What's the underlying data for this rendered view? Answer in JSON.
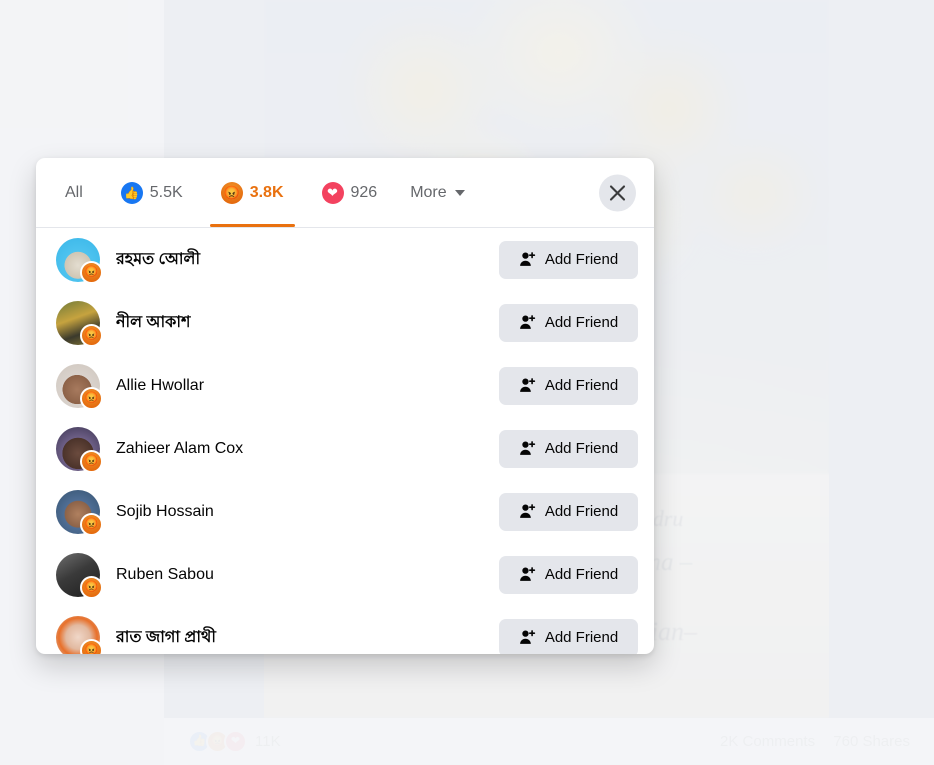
{
  "modal": {
    "close_label": "Close",
    "tabs": [
      {
        "label": "All",
        "icon": null,
        "count": null,
        "active": false
      },
      {
        "label": "Like",
        "icon": "thumbs-up-icon",
        "glyph": "👍",
        "count": "5.5K",
        "active": false
      },
      {
        "label": "Angry",
        "icon": "angry-face-icon",
        "glyph": "😡",
        "count": "3.8K",
        "active": true
      },
      {
        "label": "Love",
        "icon": "heart-icon",
        "glyph": "❤",
        "count": "926",
        "active": false
      }
    ],
    "more_label": "More",
    "active_color": "#e9710f",
    "rows": [
      {
        "name": "রহমত অোলী",
        "script": "bengali",
        "reaction": "angry-face-icon",
        "action": "Add Friend"
      },
      {
        "name": "নীল আকাশ",
        "script": "bengali",
        "reaction": "angry-face-icon",
        "action": "Add Friend"
      },
      {
        "name": "Allie Hwollar",
        "script": "latin",
        "reaction": "angry-face-icon",
        "action": "Add Friend"
      },
      {
        "name": "Zahieer Alam Cox",
        "script": "latin",
        "reaction": "angry-face-icon",
        "action": "Add Friend"
      },
      {
        "name": "Sojib Hossain",
        "script": "latin",
        "reaction": "angry-face-icon",
        "action": "Add Friend"
      },
      {
        "name": "Ruben Sabou",
        "script": "latin",
        "reaction": "angry-face-icon",
        "action": "Add Friend"
      },
      {
        "name": "রাত জাগা প্রাথী",
        "script": "bengali",
        "reaction": "angry-face-icon",
        "action": "Add Friend"
      }
    ]
  },
  "post_footer": {
    "reactions_count": "11K",
    "comments": "2K Comments",
    "shares": "760 Shares",
    "reaction_icons": [
      "thumbs-up-icon",
      "angry-face-icon",
      "heart-icon"
    ]
  },
  "background": {
    "monument_text_1": "Alexandru",
    "monument_text_2": "Catalina –",
    "monument_text_3": "HAI Alexandru – MITROI Cristian–"
  }
}
